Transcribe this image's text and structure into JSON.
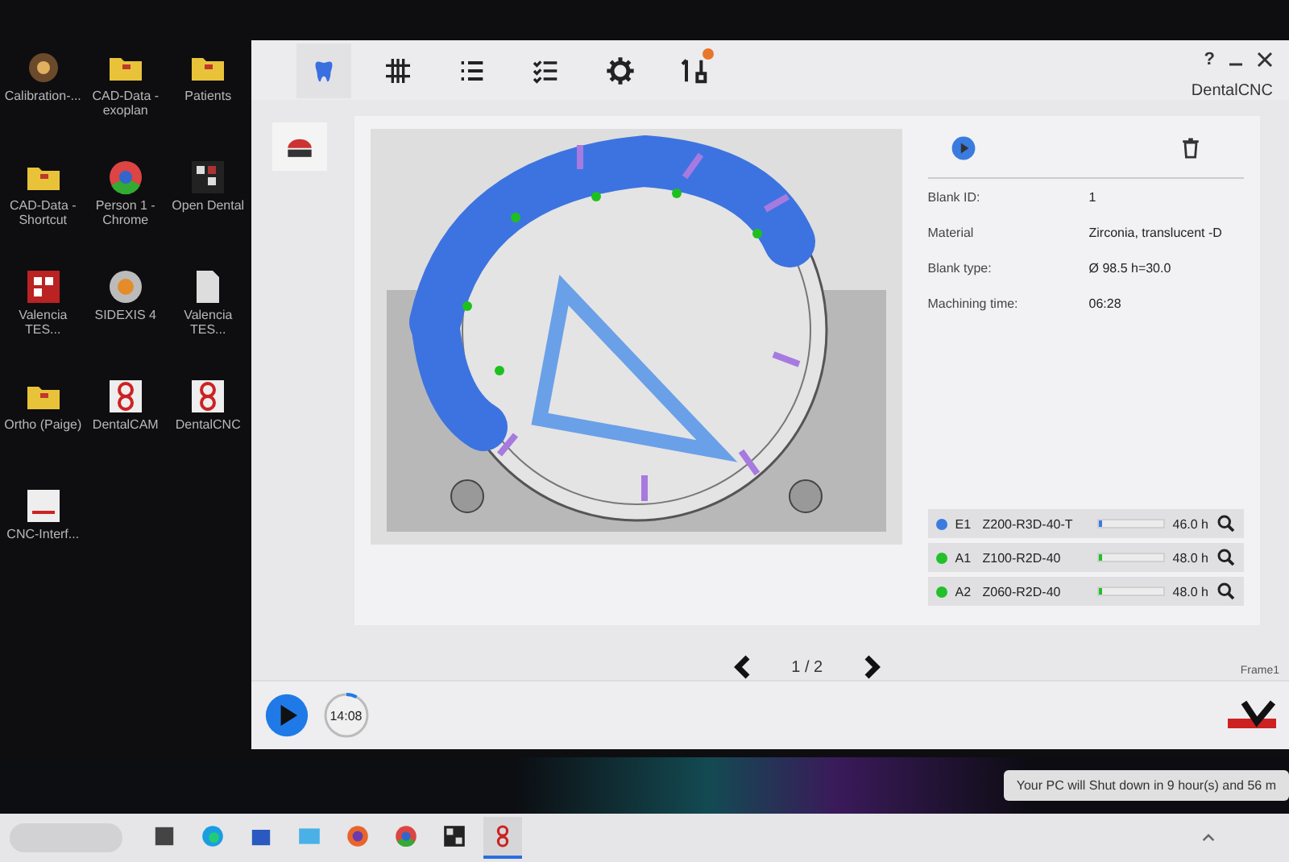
{
  "desktop": {
    "icons": [
      {
        "label": "Calibration-...",
        "kind": "app"
      },
      {
        "label": "CAD-Data - exoplan",
        "kind": "folder"
      },
      {
        "label": "Patients",
        "kind": "folder"
      },
      {
        "label": "CAD-Data - Shortcut",
        "kind": "folder"
      },
      {
        "label": "Person 1 - Chrome",
        "kind": "chrome"
      },
      {
        "label": "Open Dental",
        "kind": "grid"
      },
      {
        "label": "Valencia TES...",
        "kind": "stl"
      },
      {
        "label": "SIDEXIS 4",
        "kind": "disc"
      },
      {
        "label": "Valencia TES...",
        "kind": "file"
      },
      {
        "label": "Ortho (Paige)",
        "kind": "folder"
      },
      {
        "label": "DentalCAM",
        "kind": "eight"
      },
      {
        "label": "DentalCNC",
        "kind": "eight"
      },
      {
        "label": "CNC-Interf...",
        "kind": "doc"
      }
    ]
  },
  "app": {
    "title": "DentalCNC",
    "help": "?",
    "toolbar": [
      {
        "kind": "tooth",
        "selected": true,
        "alert": false
      },
      {
        "kind": "grid",
        "selected": false,
        "alert": false
      },
      {
        "kind": "list",
        "selected": false,
        "alert": false
      },
      {
        "kind": "checklist",
        "selected": false,
        "alert": false
      },
      {
        "kind": "gear",
        "selected": false,
        "alert": false
      },
      {
        "kind": "tools",
        "selected": false,
        "alert": true
      }
    ],
    "info": [
      {
        "label": "Blank ID:",
        "value": "1"
      },
      {
        "label": "Material",
        "value": "Zirconia, translucent -D"
      },
      {
        "label": "Blank type:",
        "value": "Ø 98.5  h=30.0"
      },
      {
        "label": "Machining time:",
        "value": "06:28"
      }
    ],
    "tools": [
      {
        "slot": "E1",
        "name": "Z200-R3D-40-T",
        "color": "#3a7be0",
        "level": 0.03,
        "time": "46.0 h"
      },
      {
        "slot": "A1",
        "name": "Z100-R2D-40",
        "color": "#22c02a",
        "level": 0.01,
        "time": "48.0 h"
      },
      {
        "slot": "A2",
        "name": "Z060-R2D-40",
        "color": "#22c02a",
        "level": 0.01,
        "time": "48.0 h"
      }
    ],
    "pager": "1 / 2",
    "frame_label": "Frame1",
    "timer": {
      "text": "14:08",
      "level": 0.08
    }
  },
  "notification": "Your PC will Shut down in 9 hour(s) and 56 m",
  "taskbar": {
    "apps": [
      {
        "kind": "taskview",
        "selected": false
      },
      {
        "kind": "edge",
        "selected": false
      },
      {
        "kind": "store",
        "selected": false
      },
      {
        "kind": "mail",
        "selected": false
      },
      {
        "kind": "firefox",
        "selected": false
      },
      {
        "kind": "chrome",
        "selected": false
      },
      {
        "kind": "grid",
        "selected": false
      },
      {
        "kind": "eight",
        "selected": true
      }
    ]
  }
}
